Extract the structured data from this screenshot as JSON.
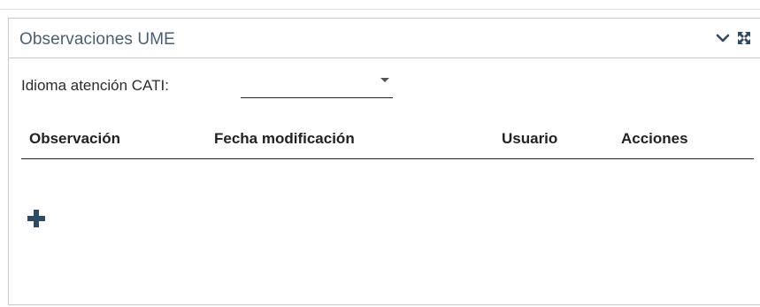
{
  "panel": {
    "title": "Observaciones UME",
    "collapse_icon": "chevron-down-icon",
    "expand_icon": "expand-icon"
  },
  "form": {
    "idioma_label": "Idioma atención CATI:",
    "idioma_value": ""
  },
  "table": {
    "columns": [
      "Observación",
      "Fecha modificación",
      "Usuario",
      "Acciones"
    ],
    "rows": []
  },
  "actions": {
    "add_icon": "plus-icon"
  },
  "colors": {
    "title": "#4a5f75",
    "icon": "#2f4a63",
    "border": "#c9c9c9"
  }
}
